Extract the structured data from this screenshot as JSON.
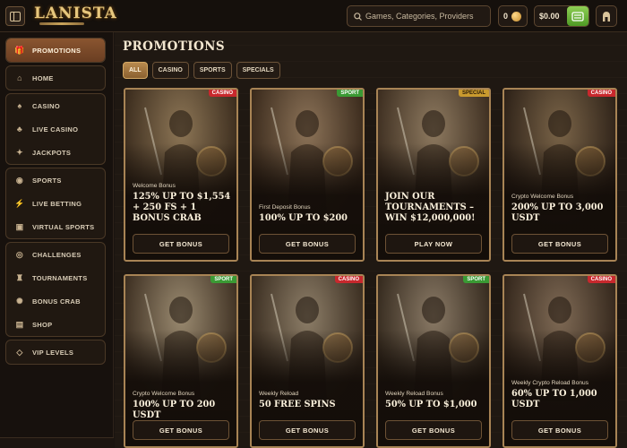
{
  "header": {
    "logo": "LANISTA",
    "search_placeholder": "Games, Categories, Providers",
    "coins": "0",
    "balance": "$0.00"
  },
  "sidebar": {
    "groups": [
      [
        {
          "label": "PROMOTIONS",
          "icon": "gift-icon",
          "active": true
        }
      ],
      [
        {
          "label": "HOME",
          "icon": "home-icon"
        }
      ],
      [
        {
          "label": "CASINO",
          "icon": "casino-icon"
        },
        {
          "label": "LIVE CASINO",
          "icon": "live-casino-icon"
        },
        {
          "label": "JACKPOTS",
          "icon": "jackpot-icon"
        }
      ],
      [
        {
          "label": "SPORTS",
          "icon": "sports-ball-icon"
        },
        {
          "label": "LIVE BETTING",
          "icon": "live-betting-icon"
        },
        {
          "label": "VIRTUAL SPORTS",
          "icon": "virtual-sports-icon"
        }
      ],
      [
        {
          "label": "CHALLENGES",
          "icon": "challenge-icon"
        },
        {
          "label": "TOURNAMENTS",
          "icon": "tournament-icon"
        },
        {
          "label": "BONUS CRAB",
          "icon": "crab-icon"
        },
        {
          "label": "SHOP",
          "icon": "shop-icon"
        }
      ],
      [
        {
          "label": "VIP LEVELS",
          "icon": "diamond-icon"
        }
      ]
    ]
  },
  "main": {
    "title": "PROMOTIONS",
    "filters": [
      {
        "label": "ALL",
        "active": true
      },
      {
        "label": "CASINO"
      },
      {
        "label": "SPORTS"
      },
      {
        "label": "SPECIALS"
      }
    ],
    "cards": [
      {
        "tag": "CASINO",
        "tag_type": "casino",
        "subtitle": "Welcome Bonus",
        "title": "125% UP TO $1,554 + 250 FS + 1 BONUS CRAB",
        "cta": "GET BONUS",
        "colors": [
          "#8d7656",
          "#3b2c1d"
        ]
      },
      {
        "tag": "SPORT",
        "tag_type": "sport",
        "subtitle": "First Deposit Bonus",
        "title": "100% UP TO $200",
        "cta": "GET BONUS",
        "colors": [
          "#8c7358",
          "#3a2a1c"
        ]
      },
      {
        "tag": "SPECIAL",
        "tag_type": "special",
        "subtitle": "",
        "title": "JOIN OUR TOURNAMENTS – WIN $12,000,000!",
        "cta": "PLAY NOW",
        "colors": [
          "#8e7a60",
          "#3d2e20"
        ]
      },
      {
        "tag": "CASINO",
        "tag_type": "casino",
        "subtitle": "Crypto Welcome Bonus",
        "title": "200% UP TO 3,000 USDT",
        "cta": "GET BONUS",
        "colors": [
          "#7a6448",
          "#2e2218"
        ]
      },
      {
        "tag": "SPORT",
        "tag_type": "sport",
        "subtitle": "Crypto Welcome Bonus",
        "title": "100% UP TO 200 USDT",
        "cta": "GET BONUS",
        "colors": [
          "#9a8a70",
          "#3e3022"
        ]
      },
      {
        "tag": "CASINO",
        "tag_type": "casino",
        "subtitle": "Weekly Reload",
        "title": "50 FREE SPINS",
        "cta": "GET BONUS",
        "colors": [
          "#8d7e68",
          "#3a2d20"
        ]
      },
      {
        "tag": "SPORT",
        "tag_type": "sport",
        "subtitle": "Weekly Reload Bonus",
        "title": "50% UP TO $1,000",
        "cta": "GET BONUS",
        "colors": [
          "#8a7a66",
          "#352a1e"
        ]
      },
      {
        "tag": "CASINO",
        "tag_type": "casino",
        "subtitle": "Weekly Crypto Reload Bonus",
        "title": "60% UP TO 1,000 USDT",
        "cta": "GET BONUS",
        "colors": [
          "#7f6a55",
          "#33261b"
        ]
      }
    ]
  }
}
